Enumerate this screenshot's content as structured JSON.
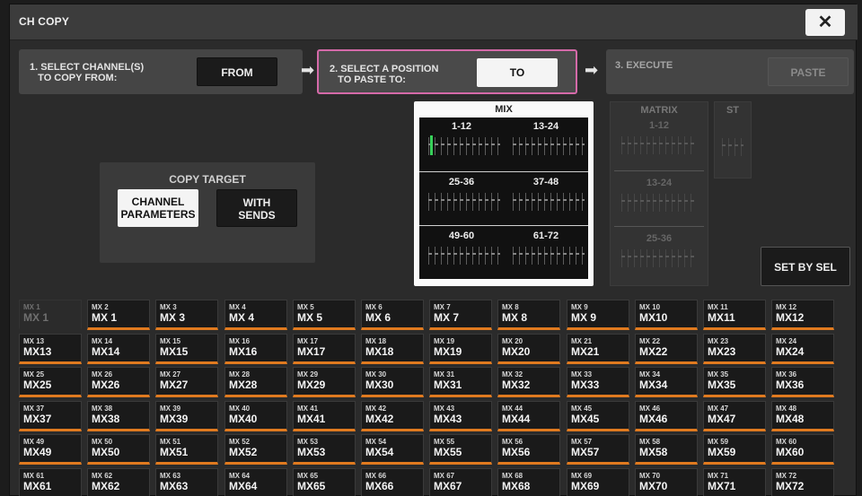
{
  "window": {
    "title": "CH COPY",
    "close_glyph": "✕"
  },
  "steps": {
    "step1": {
      "label": "1. SELECT CHANNEL(S)\n   TO COPY FROM:",
      "button": "FROM"
    },
    "step2": {
      "label": "2. SELECT A POSITION\n   TO PASTE TO:",
      "button": "TO"
    },
    "step3": {
      "label": "3. EXECUTE",
      "button": "PASTE"
    },
    "arrow_glyph": "➡",
    "step2_highlight": "#d56aa9"
  },
  "copy_target": {
    "title": "COPY TARGET",
    "channel_parameters": "CHANNEL\nPARAMETERS",
    "with_sends": "WITH\nSENDS"
  },
  "mix_panel": {
    "title": "MIX",
    "groups": [
      "1-12",
      "13-24",
      "25-36",
      "37-48",
      "49-60",
      "61-72"
    ]
  },
  "matrix_panel": {
    "title": "MATRIX",
    "groups": [
      "1-12",
      "13-24",
      "25-36"
    ]
  },
  "st_panel": {
    "title": "ST"
  },
  "set_by_sel": "SET BY SEL",
  "accent_color": "#e07a1f",
  "selected_marker_color": "#37d05a",
  "channels": [
    {
      "small": "MX 1",
      "big": "MX 1",
      "enabled": false
    },
    {
      "small": "MX 2",
      "big": "MX 1",
      "enabled": true
    },
    {
      "small": "MX 3",
      "big": "MX 3",
      "enabled": true
    },
    {
      "small": "MX 4",
      "big": "MX 4",
      "enabled": true
    },
    {
      "small": "MX 5",
      "big": "MX 5",
      "enabled": true
    },
    {
      "small": "MX 6",
      "big": "MX 6",
      "enabled": true
    },
    {
      "small": "MX 7",
      "big": "MX 7",
      "enabled": true
    },
    {
      "small": "MX 8",
      "big": "MX 8",
      "enabled": true
    },
    {
      "small": "MX 9",
      "big": "MX 9",
      "enabled": true
    },
    {
      "small": "MX 10",
      "big": "MX10",
      "enabled": true
    },
    {
      "small": "MX 11",
      "big": "MX11",
      "enabled": true
    },
    {
      "small": "MX 12",
      "big": "MX12",
      "enabled": true
    },
    {
      "small": "MX 13",
      "big": "MX13",
      "enabled": true
    },
    {
      "small": "MX 14",
      "big": "MX14",
      "enabled": true
    },
    {
      "small": "MX 15",
      "big": "MX15",
      "enabled": true
    },
    {
      "small": "MX 16",
      "big": "MX16",
      "enabled": true
    },
    {
      "small": "MX 17",
      "big": "MX17",
      "enabled": true
    },
    {
      "small": "MX 18",
      "big": "MX18",
      "enabled": true
    },
    {
      "small": "MX 19",
      "big": "MX19",
      "enabled": true
    },
    {
      "small": "MX 20",
      "big": "MX20",
      "enabled": true
    },
    {
      "small": "MX 21",
      "big": "MX21",
      "enabled": true
    },
    {
      "small": "MX 22",
      "big": "MX22",
      "enabled": true
    },
    {
      "small": "MX 23",
      "big": "MX23",
      "enabled": true
    },
    {
      "small": "MX 24",
      "big": "MX24",
      "enabled": true
    },
    {
      "small": "MX 25",
      "big": "MX25",
      "enabled": true
    },
    {
      "small": "MX 26",
      "big": "MX26",
      "enabled": true
    },
    {
      "small": "MX 27",
      "big": "MX27",
      "enabled": true
    },
    {
      "small": "MX 28",
      "big": "MX28",
      "enabled": true
    },
    {
      "small": "MX 29",
      "big": "MX29",
      "enabled": true
    },
    {
      "small": "MX 30",
      "big": "MX30",
      "enabled": true
    },
    {
      "small": "MX 31",
      "big": "MX31",
      "enabled": true
    },
    {
      "small": "MX 32",
      "big": "MX32",
      "enabled": true
    },
    {
      "small": "MX 33",
      "big": "MX33",
      "enabled": true
    },
    {
      "small": "MX 34",
      "big": "MX34",
      "enabled": true
    },
    {
      "small": "MX 35",
      "big": "MX35",
      "enabled": true
    },
    {
      "small": "MX 36",
      "big": "MX36",
      "enabled": true
    },
    {
      "small": "MX 37",
      "big": "MX37",
      "enabled": true
    },
    {
      "small": "MX 38",
      "big": "MX38",
      "enabled": true
    },
    {
      "small": "MX 39",
      "big": "MX39",
      "enabled": true
    },
    {
      "small": "MX 40",
      "big": "MX40",
      "enabled": true
    },
    {
      "small": "MX 41",
      "big": "MX41",
      "enabled": true
    },
    {
      "small": "MX 42",
      "big": "MX42",
      "enabled": true
    },
    {
      "small": "MX 43",
      "big": "MX43",
      "enabled": true
    },
    {
      "small": "MX 44",
      "big": "MX44",
      "enabled": true
    },
    {
      "small": "MX 45",
      "big": "MX45",
      "enabled": true
    },
    {
      "small": "MX 46",
      "big": "MX46",
      "enabled": true
    },
    {
      "small": "MX 47",
      "big": "MX47",
      "enabled": true
    },
    {
      "small": "MX 48",
      "big": "MX48",
      "enabled": true
    },
    {
      "small": "MX 49",
      "big": "MX49",
      "enabled": true
    },
    {
      "small": "MX 50",
      "big": "MX50",
      "enabled": true
    },
    {
      "small": "MX 51",
      "big": "MX51",
      "enabled": true
    },
    {
      "small": "MX 52",
      "big": "MX52",
      "enabled": true
    },
    {
      "small": "MX 53",
      "big": "MX53",
      "enabled": true
    },
    {
      "small": "MX 54",
      "big": "MX54",
      "enabled": true
    },
    {
      "small": "MX 55",
      "big": "MX55",
      "enabled": true
    },
    {
      "small": "MX 56",
      "big": "MX56",
      "enabled": true
    },
    {
      "small": "MX 57",
      "big": "MX57",
      "enabled": true
    },
    {
      "small": "MX 58",
      "big": "MX58",
      "enabled": true
    },
    {
      "small": "MX 59",
      "big": "MX59",
      "enabled": true
    },
    {
      "small": "MX 60",
      "big": "MX60",
      "enabled": true
    },
    {
      "small": "MX 61",
      "big": "MX61",
      "enabled": true
    },
    {
      "small": "MX 62",
      "big": "MX62",
      "enabled": true
    },
    {
      "small": "MX 63",
      "big": "MX63",
      "enabled": true
    },
    {
      "small": "MX 64",
      "big": "MX64",
      "enabled": true
    },
    {
      "small": "MX 65",
      "big": "MX65",
      "enabled": true
    },
    {
      "small": "MX 66",
      "big": "MX66",
      "enabled": true
    },
    {
      "small": "MX 67",
      "big": "MX67",
      "enabled": true
    },
    {
      "small": "MX 68",
      "big": "MX68",
      "enabled": true
    },
    {
      "small": "MX 69",
      "big": "MX69",
      "enabled": true
    },
    {
      "small": "MX 70",
      "big": "MX70",
      "enabled": true
    },
    {
      "small": "MX 71",
      "big": "MX71",
      "enabled": true
    },
    {
      "small": "MX 72",
      "big": "MX72",
      "enabled": true
    }
  ]
}
